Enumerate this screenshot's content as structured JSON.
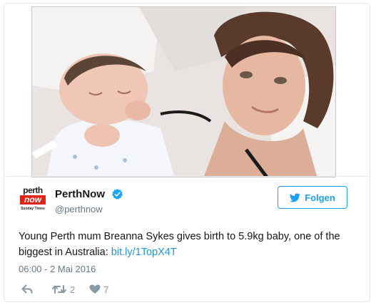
{
  "media": {
    "icon": "photo-of-mother-holding-newborn"
  },
  "author": {
    "logo": {
      "line1": "perth",
      "line2": "now",
      "line3": "Sunday Times"
    },
    "display_name": "PerthNow",
    "handle": "@perthnow",
    "verified_icon": "verified-badge-icon"
  },
  "follow_button": {
    "label": "Folgen",
    "icon": "twitter-bird-icon"
  },
  "tweet": {
    "text": "Young Perth mum Breanna Sykes gives birth to 5.9kg baby, one of the biggest in Australia: ",
    "link": "bit.ly/1TopX4T"
  },
  "timestamp": "06:00 - 2 Mai 2016",
  "actions": {
    "reply_icon": "reply-icon",
    "retweet_icon": "retweet-icon",
    "retweet_count": "2",
    "like_icon": "heart-icon",
    "like_count": "7"
  },
  "colors": {
    "accent": "#1da1f2",
    "link": "#1b95e0",
    "muted": "#657786",
    "text": "#14171a",
    "brand_red": "#e2231a"
  }
}
